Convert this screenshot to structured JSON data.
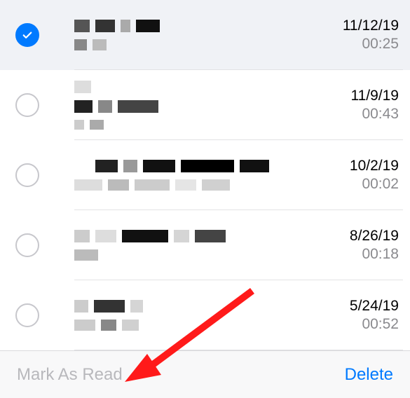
{
  "items": [
    {
      "selected": true,
      "date": "11/12/19",
      "time": "00:25"
    },
    {
      "selected": false,
      "date": "11/9/19",
      "time": "00:43"
    },
    {
      "selected": false,
      "date": "10/2/19",
      "time": "00:02"
    },
    {
      "selected": false,
      "date": "8/26/19",
      "time": "00:18"
    },
    {
      "selected": false,
      "date": "5/24/19",
      "time": "00:52"
    }
  ],
  "toolbar": {
    "mark_read_label": "Mark As Read",
    "delete_label": "Delete"
  },
  "colors": {
    "accent": "#007aff",
    "secondary_text": "#8a8a8e",
    "disabled_text": "#b8b8bc"
  }
}
